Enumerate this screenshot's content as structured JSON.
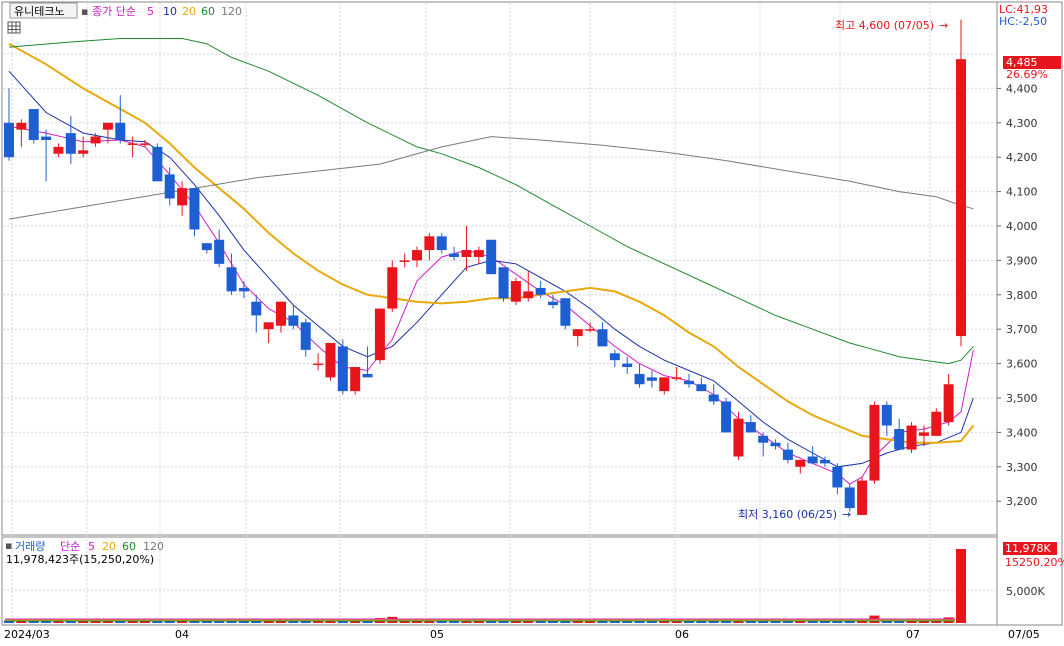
{
  "header": {
    "stock_name": "유니테크노",
    "indicator": "종가 단순",
    "ma_periods": [
      "5",
      "10",
      "20",
      "60",
      "120"
    ],
    "lc_label": "LC:41,93",
    "hc_label": "HC:-2,50"
  },
  "volume_header": {
    "title": "거래량",
    "indicator": "단순",
    "ma_periods": [
      "5",
      "20",
      "60",
      "120"
    ],
    "summary": "11,978,423주(15,250,20%)"
  },
  "annotations": {
    "high": "최고 4,600 (07/05)",
    "low": "최저 3,160 (06/25)"
  },
  "price_badge": {
    "value": "4,485",
    "change": "26.69%"
  },
  "volume_badges": {
    "value": "11,978K",
    "ma": "15250.20%"
  },
  "x_axis_labels": [
    "2024/03",
    "04",
    "05",
    "06",
    "07",
    "07/05"
  ],
  "colors": {
    "up": "#e8161c",
    "down": "#1d5fd1",
    "ma5": "#d21cc8",
    "ma10": "#1a2fa8",
    "ma20": "#e8a90c",
    "ma60": "#1f8a2e",
    "ma120": "#7a7a7a"
  },
  "chart_data": {
    "type": "candlestick",
    "ylabel": "",
    "y_ticks": [
      "4,500",
      "4,400",
      "4,300",
      "4,200",
      "4,100",
      "4,000",
      "3,900",
      "3,800",
      "3,700",
      "3,600",
      "3,500",
      "3,400",
      "3,300",
      "3,200"
    ],
    "ylim": [
      3100,
      4650
    ],
    "volume_ticks": [
      "5,000K"
    ],
    "candles": [
      {
        "o": 4300,
        "h": 4400,
        "l": 4190,
        "c": 4200
      },
      {
        "o": 4280,
        "h": 4310,
        "l": 4230,
        "c": 4300
      },
      {
        "o": 4340,
        "h": 4340,
        "l": 4240,
        "c": 4250
      },
      {
        "o": 4260,
        "h": 4280,
        "l": 4130,
        "c": 4250
      },
      {
        "o": 4210,
        "h": 4240,
        "l": 4200,
        "c": 4230
      },
      {
        "o": 4270,
        "h": 4320,
        "l": 4180,
        "c": 4210
      },
      {
        "o": 4210,
        "h": 4260,
        "l": 4200,
        "c": 4220
      },
      {
        "o": 4240,
        "h": 4270,
        "l": 4230,
        "c": 4260
      },
      {
        "o": 4280,
        "h": 4300,
        "l": 4240,
        "c": 4300
      },
      {
        "o": 4300,
        "h": 4380,
        "l": 4240,
        "c": 4250
      },
      {
        "o": 4240,
        "h": 4260,
        "l": 4200,
        "c": 4240
      },
      {
        "o": 4240,
        "h": 4250,
        "l": 4230,
        "c": 4240
      },
      {
        "o": 4230,
        "h": 4240,
        "l": 4130,
        "c": 4130
      },
      {
        "o": 4150,
        "h": 4170,
        "l": 4060,
        "c": 4080
      },
      {
        "o": 4060,
        "h": 4130,
        "l": 4030,
        "c": 4110
      },
      {
        "o": 4110,
        "h": 4110,
        "l": 3970,
        "c": 3990
      },
      {
        "o": 3950,
        "h": 3950,
        "l": 3920,
        "c": 3930
      },
      {
        "o": 3960,
        "h": 3990,
        "l": 3880,
        "c": 3890
      },
      {
        "o": 3880,
        "h": 3920,
        "l": 3800,
        "c": 3810
      },
      {
        "o": 3820,
        "h": 3840,
        "l": 3790,
        "c": 3810
      },
      {
        "o": 3780,
        "h": 3800,
        "l": 3690,
        "c": 3740
      },
      {
        "o": 3700,
        "h": 3720,
        "l": 3660,
        "c": 3720
      },
      {
        "o": 3710,
        "h": 3780,
        "l": 3690,
        "c": 3780
      },
      {
        "o": 3740,
        "h": 3770,
        "l": 3700,
        "c": 3710
      },
      {
        "o": 3720,
        "h": 3730,
        "l": 3620,
        "c": 3640
      },
      {
        "o": 3600,
        "h": 3630,
        "l": 3580,
        "c": 3600
      },
      {
        "o": 3560,
        "h": 3630,
        "l": 3550,
        "c": 3660
      },
      {
        "o": 3650,
        "h": 3670,
        "l": 3510,
        "c": 3520
      },
      {
        "o": 3520,
        "h": 3560,
        "l": 3510,
        "c": 3590
      },
      {
        "o": 3570,
        "h": 3650,
        "l": 3560,
        "c": 3560
      },
      {
        "o": 3610,
        "h": 3640,
        "l": 3600,
        "c": 3760
      },
      {
        "o": 3760,
        "h": 3900,
        "l": 3750,
        "c": 3880
      },
      {
        "o": 3900,
        "h": 3920,
        "l": 3880,
        "c": 3900
      },
      {
        "o": 3900,
        "h": 3940,
        "l": 3880,
        "c": 3930
      },
      {
        "o": 3930,
        "h": 3980,
        "l": 3900,
        "c": 3970
      },
      {
        "o": 3970,
        "h": 3980,
        "l": 3920,
        "c": 3930
      },
      {
        "o": 3920,
        "h": 3940,
        "l": 3900,
        "c": 3910
      },
      {
        "o": 3910,
        "h": 4000,
        "l": 3870,
        "c": 3930
      },
      {
        "o": 3910,
        "h": 3940,
        "l": 3890,
        "c": 3930
      },
      {
        "o": 3960,
        "h": 3960,
        "l": 3860,
        "c": 3860
      },
      {
        "o": 3880,
        "h": 3880,
        "l": 3780,
        "c": 3790
      },
      {
        "o": 3780,
        "h": 3850,
        "l": 3770,
        "c": 3840
      },
      {
        "o": 3790,
        "h": 3870,
        "l": 3780,
        "c": 3810
      },
      {
        "o": 3820,
        "h": 3840,
        "l": 3790,
        "c": 3800
      },
      {
        "o": 3780,
        "h": 3800,
        "l": 3760,
        "c": 3770
      },
      {
        "o": 3790,
        "h": 3790,
        "l": 3700,
        "c": 3710
      },
      {
        "o": 3680,
        "h": 3700,
        "l": 3650,
        "c": 3700
      },
      {
        "o": 3700,
        "h": 3720,
        "l": 3690,
        "c": 3700
      },
      {
        "o": 3700,
        "h": 3720,
        "l": 3650,
        "c": 3650
      },
      {
        "o": 3630,
        "h": 3640,
        "l": 3590,
        "c": 3610
      },
      {
        "o": 3600,
        "h": 3620,
        "l": 3570,
        "c": 3590
      },
      {
        "o": 3570,
        "h": 3600,
        "l": 3530,
        "c": 3540
      },
      {
        "o": 3560,
        "h": 3580,
        "l": 3530,
        "c": 3550
      },
      {
        "o": 3520,
        "h": 3560,
        "l": 3510,
        "c": 3560
      },
      {
        "o": 3560,
        "h": 3590,
        "l": 3550,
        "c": 3560
      },
      {
        "o": 3550,
        "h": 3570,
        "l": 3530,
        "c": 3540
      },
      {
        "o": 3540,
        "h": 3560,
        "l": 3520,
        "c": 3520
      },
      {
        "o": 3510,
        "h": 3540,
        "l": 3480,
        "c": 3490
      },
      {
        "o": 3490,
        "h": 3500,
        "l": 3400,
        "c": 3400
      },
      {
        "o": 3330,
        "h": 3460,
        "l": 3320,
        "c": 3440
      },
      {
        "o": 3430,
        "h": 3450,
        "l": 3400,
        "c": 3400
      },
      {
        "o": 3390,
        "h": 3400,
        "l": 3330,
        "c": 3370
      },
      {
        "o": 3370,
        "h": 3380,
        "l": 3350,
        "c": 3360
      },
      {
        "o": 3350,
        "h": 3370,
        "l": 3310,
        "c": 3320
      },
      {
        "o": 3300,
        "h": 3320,
        "l": 3280,
        "c": 3320
      },
      {
        "o": 3330,
        "h": 3360,
        "l": 3310,
        "c": 3310
      },
      {
        "o": 3320,
        "h": 3330,
        "l": 3300,
        "c": 3310
      },
      {
        "o": 3300,
        "h": 3310,
        "l": 3220,
        "c": 3240
      },
      {
        "o": 3240,
        "h": 3250,
        "l": 3170,
        "c": 3180
      },
      {
        "o": 3160,
        "h": 3270,
        "l": 3160,
        "c": 3260
      },
      {
        "o": 3260,
        "h": 3490,
        "l": 3250,
        "c": 3480
      },
      {
        "o": 3480,
        "h": 3490,
        "l": 3390,
        "c": 3420
      },
      {
        "o": 3410,
        "h": 3440,
        "l": 3350,
        "c": 3350
      },
      {
        "o": 3350,
        "h": 3430,
        "l": 3340,
        "c": 3420
      },
      {
        "o": 3390,
        "h": 3420,
        "l": 3360,
        "c": 3400
      },
      {
        "o": 3390,
        "h": 3470,
        "l": 3390,
        "c": 3460
      },
      {
        "o": 3430,
        "h": 3570,
        "l": 3420,
        "c": 3540
      },
      {
        "o": 3680,
        "h": 4600,
        "l": 3650,
        "c": 4485
      }
    ],
    "ma_series": [
      {
        "name": "5",
        "points": [
          [
            0,
            4290
          ],
          [
            3,
            4270
          ],
          [
            6,
            4245
          ],
          [
            9,
            4250
          ],
          [
            11,
            4230
          ],
          [
            13,
            4150
          ],
          [
            15,
            4060
          ],
          [
            17,
            3950
          ],
          [
            19,
            3830
          ],
          [
            21,
            3760
          ],
          [
            23,
            3720
          ],
          [
            25,
            3650
          ],
          [
            27,
            3590
          ],
          [
            29,
            3580
          ],
          [
            31,
            3670
          ],
          [
            33,
            3840
          ],
          [
            35,
            3910
          ],
          [
            37,
            3930
          ],
          [
            39,
            3910
          ],
          [
            41,
            3860
          ],
          [
            43,
            3810
          ],
          [
            45,
            3770
          ],
          [
            47,
            3710
          ],
          [
            49,
            3650
          ],
          [
            51,
            3600
          ],
          [
            53,
            3565
          ],
          [
            55,
            3550
          ],
          [
            57,
            3510
          ],
          [
            59,
            3440
          ],
          [
            61,
            3390
          ],
          [
            63,
            3340
          ],
          [
            65,
            3310
          ],
          [
            67,
            3280
          ],
          [
            68,
            3250
          ],
          [
            69,
            3270
          ],
          [
            70,
            3330
          ],
          [
            72,
            3400
          ],
          [
            74,
            3410
          ],
          [
            76,
            3430
          ],
          [
            77,
            3460
          ],
          [
            78,
            3640
          ]
        ]
      },
      {
        "name": "10",
        "points": [
          [
            0,
            4450
          ],
          [
            3,
            4330
          ],
          [
            6,
            4270
          ],
          [
            9,
            4250
          ],
          [
            11,
            4245
          ],
          [
            13,
            4200
          ],
          [
            15,
            4120
          ],
          [
            17,
            4030
          ],
          [
            19,
            3930
          ],
          [
            21,
            3850
          ],
          [
            23,
            3770
          ],
          [
            25,
            3710
          ],
          [
            27,
            3650
          ],
          [
            29,
            3620
          ],
          [
            31,
            3650
          ],
          [
            33,
            3720
          ],
          [
            35,
            3800
          ],
          [
            37,
            3880
          ],
          [
            39,
            3900
          ],
          [
            41,
            3890
          ],
          [
            43,
            3850
          ],
          [
            45,
            3810
          ],
          [
            47,
            3760
          ],
          [
            49,
            3700
          ],
          [
            51,
            3650
          ],
          [
            53,
            3610
          ],
          [
            55,
            3580
          ],
          [
            57,
            3550
          ],
          [
            59,
            3490
          ],
          [
            61,
            3430
          ],
          [
            63,
            3380
          ],
          [
            65,
            3340
          ],
          [
            67,
            3300
          ],
          [
            69,
            3310
          ],
          [
            71,
            3340
          ],
          [
            73,
            3360
          ],
          [
            75,
            3370
          ],
          [
            77,
            3400
          ],
          [
            78,
            3500
          ]
        ]
      },
      {
        "name": "20",
        "points": [
          [
            0,
            4530
          ],
          [
            3,
            4470
          ],
          [
            6,
            4400
          ],
          [
            9,
            4340
          ],
          [
            11,
            4300
          ],
          [
            13,
            4240
          ],
          [
            15,
            4170
          ],
          [
            17,
            4110
          ],
          [
            19,
            4050
          ],
          [
            21,
            3980
          ],
          [
            23,
            3920
          ],
          [
            25,
            3870
          ],
          [
            27,
            3830
          ],
          [
            29,
            3800
          ],
          [
            31,
            3790
          ],
          [
            33,
            3780
          ],
          [
            35,
            3775
          ],
          [
            37,
            3780
          ],
          [
            39,
            3790
          ],
          [
            41,
            3790
          ],
          [
            43,
            3800
          ],
          [
            45,
            3810
          ],
          [
            47,
            3820
          ],
          [
            49,
            3810
          ],
          [
            51,
            3780
          ],
          [
            53,
            3740
          ],
          [
            55,
            3690
          ],
          [
            57,
            3650
          ],
          [
            59,
            3590
          ],
          [
            61,
            3540
          ],
          [
            63,
            3490
          ],
          [
            65,
            3450
          ],
          [
            67,
            3420
          ],
          [
            69,
            3390
          ],
          [
            71,
            3380
          ],
          [
            73,
            3370
          ],
          [
            75,
            3370
          ],
          [
            77,
            3375
          ],
          [
            78,
            3420
          ]
        ]
      },
      {
        "name": "60",
        "points": [
          [
            0,
            4520
          ],
          [
            5,
            4535
          ],
          [
            9,
            4545
          ],
          [
            14,
            4545
          ],
          [
            16,
            4530
          ],
          [
            18,
            4490
          ],
          [
            21,
            4450
          ],
          [
            25,
            4380
          ],
          [
            29,
            4300
          ],
          [
            33,
            4230
          ],
          [
            35,
            4210
          ],
          [
            38,
            4170
          ],
          [
            41,
            4120
          ],
          [
            44,
            4060
          ],
          [
            47,
            4000
          ],
          [
            50,
            3940
          ],
          [
            53,
            3890
          ],
          [
            56,
            3840
          ],
          [
            59,
            3790
          ],
          [
            62,
            3740
          ],
          [
            65,
            3700
          ],
          [
            68,
            3660
          ],
          [
            70,
            3640
          ],
          [
            72,
            3620
          ],
          [
            74,
            3610
          ],
          [
            76,
            3600
          ],
          [
            77,
            3610
          ],
          [
            78,
            3650
          ]
        ]
      },
      {
        "name": "120",
        "points": [
          [
            0,
            4020
          ],
          [
            5,
            4050
          ],
          [
            10,
            4080
          ],
          [
            15,
            4110
          ],
          [
            20,
            4140
          ],
          [
            25,
            4160
          ],
          [
            30,
            4180
          ],
          [
            35,
            4230
          ],
          [
            39,
            4260
          ],
          [
            43,
            4250
          ],
          [
            48,
            4235
          ],
          [
            53,
            4215
          ],
          [
            58,
            4190
          ],
          [
            63,
            4160
          ],
          [
            68,
            4130
          ],
          [
            72,
            4100
          ],
          [
            75,
            4085
          ],
          [
            77,
            4060
          ],
          [
            78,
            4050
          ]
        ]
      }
    ],
    "volume": [
      0.4,
      0.5,
      0.4,
      0.3,
      0.3,
      0.4,
      0.3,
      0.3,
      0.3,
      0.4,
      0.3,
      0.3,
      0.5,
      0.5,
      0.3,
      0.5,
      0.3,
      0.4,
      0.4,
      0.3,
      0.4,
      0.3,
      0.4,
      0.3,
      0.4,
      0.3,
      0.4,
      0.5,
      0.3,
      0.3,
      0.8,
      1.0,
      0.4,
      0.4,
      0.5,
      0.4,
      0.3,
      0.4,
      0.3,
      0.5,
      0.5,
      0.4,
      0.4,
      0.3,
      0.3,
      0.5,
      0.3,
      0.3,
      0.4,
      0.3,
      0.3,
      0.4,
      0.3,
      0.3,
      0.3,
      0.3,
      0.3,
      0.4,
      0.5,
      0.5,
      0.3,
      0.3,
      0.3,
      0.3,
      0.3,
      0.3,
      0.3,
      0.5,
      0.5,
      0.6,
      1.2,
      0.7,
      0.5,
      0.5,
      0.4,
      0.5,
      0.9,
      11.978
    ]
  }
}
